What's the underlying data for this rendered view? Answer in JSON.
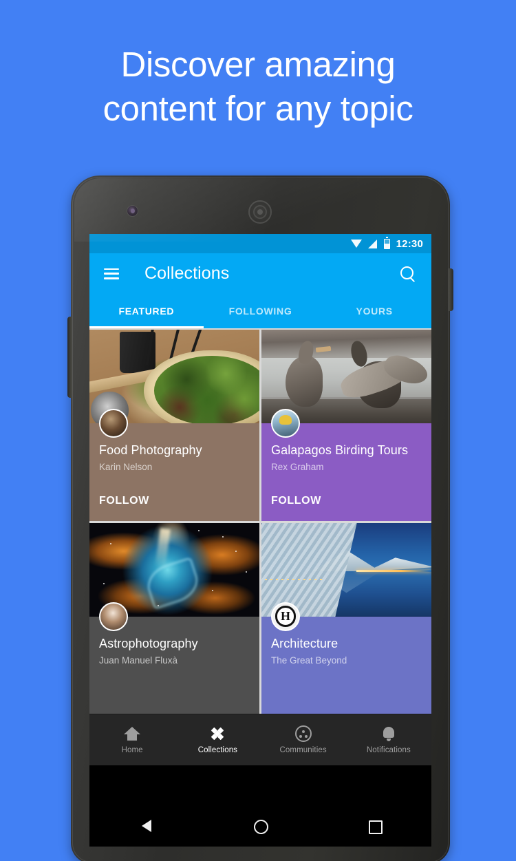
{
  "promo": {
    "headline_line1": "Discover amazing",
    "headline_line2": "content for any topic",
    "background_color": "#4280F4"
  },
  "device": {
    "camera_icon": "front-camera",
    "speaker_icon": "earpiece-speaker",
    "power_button": "power-button",
    "volume_button": "volume-rocker"
  },
  "status_bar": {
    "time": "12:30",
    "wifi_icon": "wifi-icon",
    "signal_icon": "cell-signal-icon",
    "battery_icon": "battery-icon",
    "background_color": "#0193D6"
  },
  "app_bar": {
    "menu_icon": "hamburger-menu-icon",
    "title": "Collections",
    "search_icon": "search-icon",
    "background_color": "#03A9F4"
  },
  "tabs": {
    "active_index": 0,
    "items": [
      {
        "label": "FEATURED"
      },
      {
        "label": "FOLLOWING"
      },
      {
        "label": "YOURS"
      }
    ]
  },
  "collections": [
    {
      "title": "Food Photography",
      "author": "Karin Nelson",
      "follow_label": "FOLLOW",
      "card_color": "#8d7464",
      "photo_alt": "salad flatbread on wooden table"
    },
    {
      "title": "Galapagos Birding Tours",
      "author": "Rex Graham",
      "follow_label": "FOLLOW",
      "card_color": "#8b5cc4",
      "photo_alt": "two cormorants on rocky shore"
    },
    {
      "title": "Astrophotography",
      "author": "Juan Manuel Fluxà",
      "follow_label": "",
      "card_color": "#4f4f4f",
      "photo_alt": "colorful nebula in deep space"
    },
    {
      "title": "Architecture",
      "author": "The Great Beyond",
      "follow_label": "",
      "card_color": "#6c73c6",
      "photo_alt": "modern white architecture reflected in water"
    }
  ],
  "bottom_nav": {
    "active_index": 1,
    "items": [
      {
        "label": "Home",
        "icon": "home-icon"
      },
      {
        "label": "Collections",
        "icon": "collections-diamond-icon"
      },
      {
        "label": "Communities",
        "icon": "communities-icon"
      },
      {
        "label": "Notifications",
        "icon": "bell-icon"
      }
    ]
  },
  "system_nav": {
    "back_icon": "back-triangle-icon",
    "home_icon": "home-circle-icon",
    "recents_icon": "recents-square-icon"
  }
}
